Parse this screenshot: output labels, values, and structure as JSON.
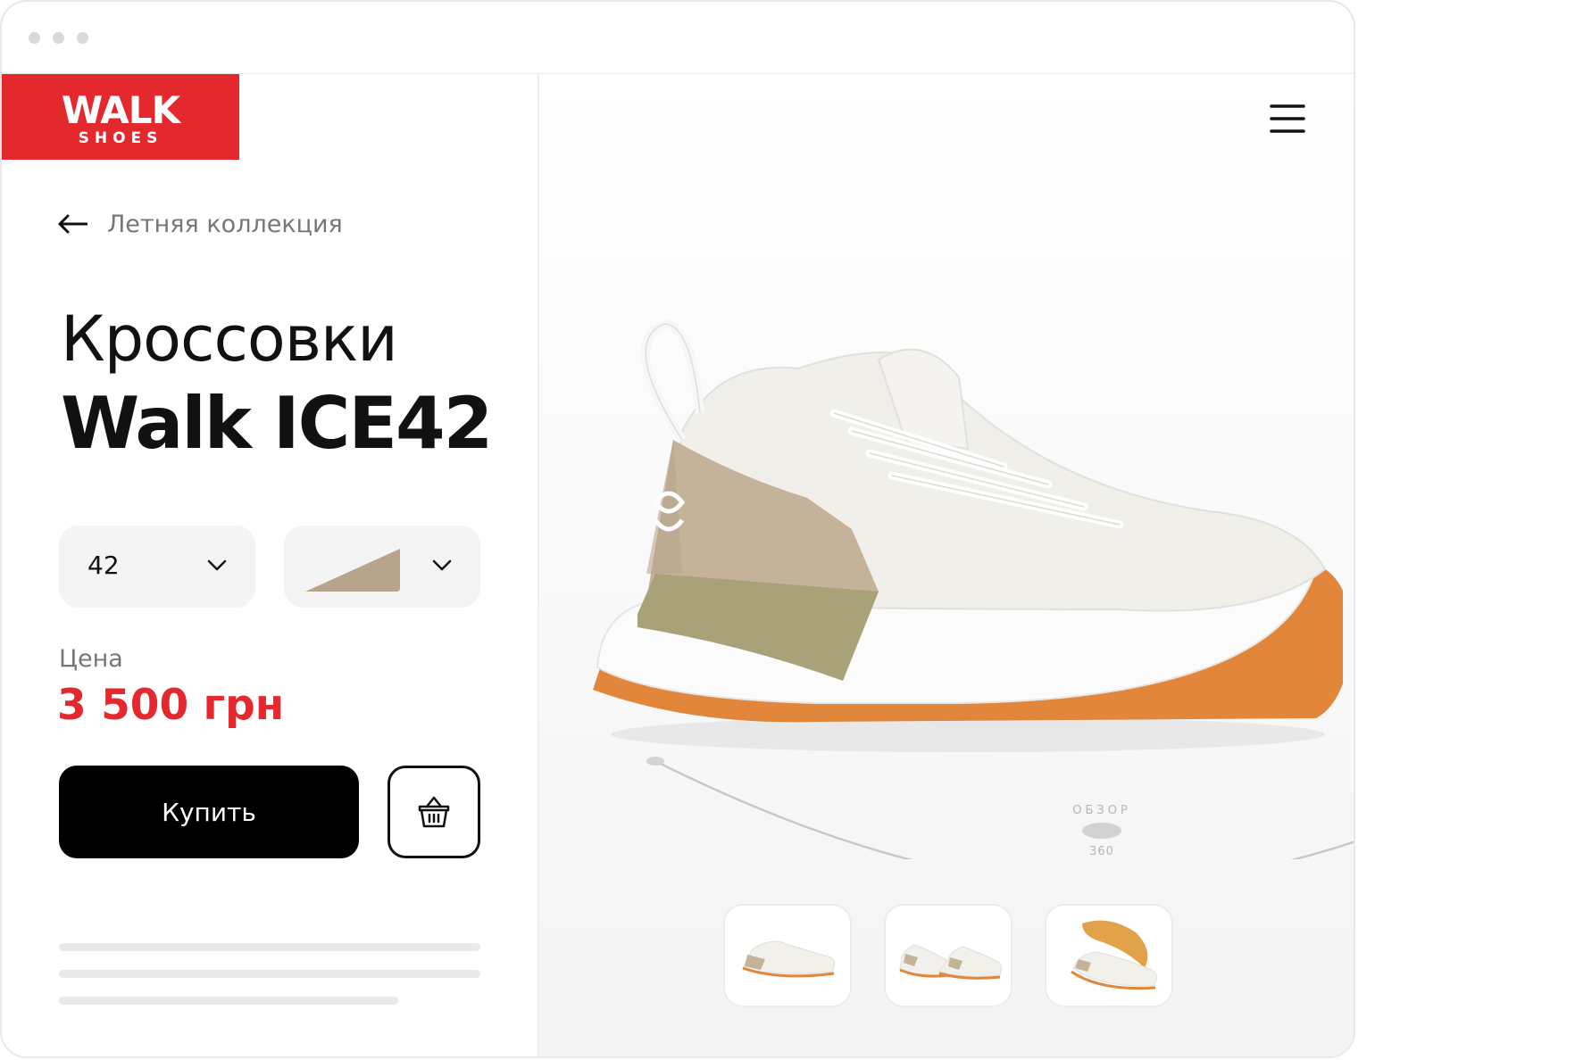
{
  "brand": {
    "name": "WALK",
    "sub": "SHOES",
    "color": "#e3292e"
  },
  "nav": {
    "back_label": "Летняя коллекция",
    "back_icon": "arrow-left-icon",
    "menu_icon": "hamburger-menu-icon"
  },
  "product": {
    "title_line1": "Кроссовки",
    "title_line2": "Walk ICE42",
    "size": "42",
    "color_swatch": "#b8a48d",
    "price_label": "Цена",
    "price": "3 500 грн"
  },
  "actions": {
    "buy_label": "Купить",
    "cart_icon": "basket-icon"
  },
  "viewer": {
    "overview_label": "ОБЗОР",
    "rotation_label": "360"
  },
  "thumbnails": [
    {
      "name": "side-view"
    },
    {
      "name": "pair-view"
    },
    {
      "name": "sole-view"
    }
  ]
}
